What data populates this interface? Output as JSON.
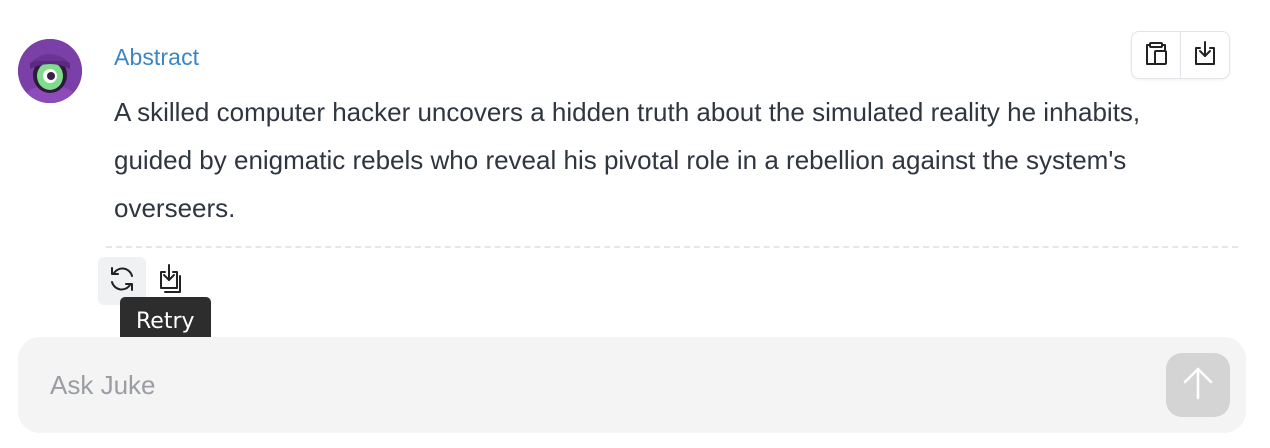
{
  "message": {
    "avatar_icon": "cyclops-eye-avatar-icon",
    "title": "Abstract",
    "body": "A skilled computer hacker uncovers a hidden truth about the simulated reality he inhabits, guided by enigmatic rebels who reveal his pivotal role in a rebellion against the system's overseers.",
    "top_actions": [
      {
        "name": "copy",
        "icon": "clipboard-copy-icon"
      },
      {
        "name": "save",
        "icon": "save-download-icon"
      }
    ]
  },
  "actions": {
    "retry_icon": "refresh-icon",
    "save_icon": "save-to-notes-icon",
    "tooltip": "Retry"
  },
  "composer": {
    "placeholder": "Ask Juke",
    "value": "",
    "send_icon": "arrow-up-icon"
  },
  "colors": {
    "accent": "#3a86c4",
    "avatar_bg": "#7b3fa8",
    "text": "#2f3640",
    "tooltip_bg": "#2d2d2d",
    "composer_bg": "#f4f4f4",
    "send_disabled_bg": "#d4d4d4"
  }
}
